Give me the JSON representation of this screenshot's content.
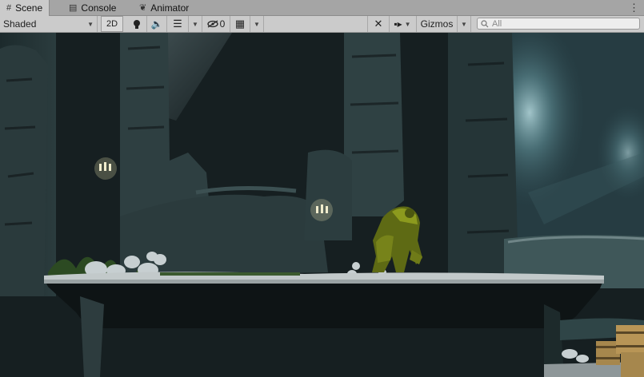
{
  "tabs": [
    {
      "label": "Scene",
      "icon": "hash-icon"
    },
    {
      "label": "Console",
      "icon": "console-icon"
    },
    {
      "label": "Animator",
      "icon": "animator-icon"
    }
  ],
  "toolbar": {
    "shading_mode": "Shaded",
    "mode_2d": "2D",
    "hidden_count": "0",
    "gizmos_label": "Gizmos",
    "search_placeholder": "All"
  }
}
